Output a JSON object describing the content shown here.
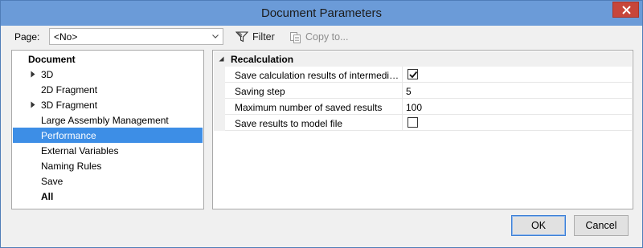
{
  "window": {
    "title": "Document Parameters"
  },
  "toolbar": {
    "page_label": "Page:",
    "page_value": "<No>",
    "filter_label": "Filter",
    "copy_label": "Copy to..."
  },
  "tree": {
    "items": [
      {
        "label": "Document",
        "bold": true
      },
      {
        "label": "3D",
        "expandable": true
      },
      {
        "label": "2D Fragment"
      },
      {
        "label": "3D Fragment",
        "expandable": true
      },
      {
        "label": "Large Assembly Management"
      },
      {
        "label": "Performance",
        "selected": true
      },
      {
        "label": "External Variables"
      },
      {
        "label": "Naming Rules"
      },
      {
        "label": "Save"
      },
      {
        "label": "All",
        "bold": true
      }
    ]
  },
  "properties": {
    "group_label": "Recalculation",
    "rows": [
      {
        "name": "Save calculation results of intermedia...",
        "type": "checkbox",
        "checked": true
      },
      {
        "name": "Saving step",
        "value": "5"
      },
      {
        "name": "Maximum number of saved results",
        "value": "100"
      },
      {
        "name": "Save results to model file",
        "type": "checkbox",
        "checked": false
      }
    ]
  },
  "buttons": {
    "ok": "OK",
    "cancel": "Cancel"
  },
  "colors": {
    "titlebar": "#6b9bd8",
    "close": "#c7463a",
    "selection": "#3d8ee6"
  }
}
